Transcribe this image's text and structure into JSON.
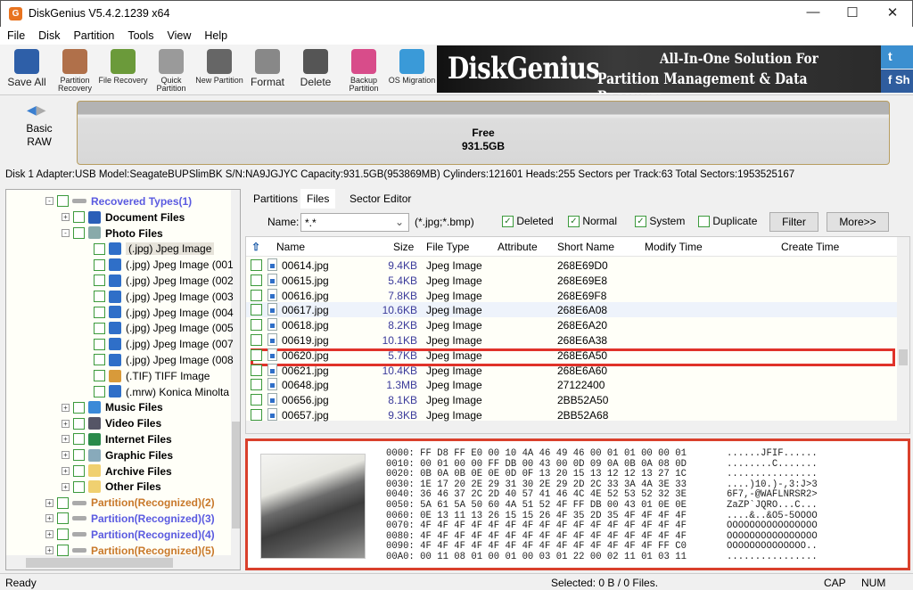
{
  "window": {
    "title": "DiskGenius V5.4.2.1239 x64",
    "logo": "G"
  },
  "menu": [
    "File",
    "Disk",
    "Partition",
    "Tools",
    "View",
    "Help"
  ],
  "toolbar": [
    {
      "label": "Save All",
      "icon": "save-icon",
      "color": "#2e5fa8",
      "big": true
    },
    {
      "label": "Partition Recovery",
      "icon": "magnifier-icon",
      "color": "#b0704a"
    },
    {
      "label": "File Recovery",
      "icon": "file-recovery-icon",
      "color": "#6b9a3a"
    },
    {
      "label": "Quick Partition",
      "icon": "quick-partition-icon",
      "color": "#9a9a9a"
    },
    {
      "label": "New Partition",
      "icon": "layers-icon",
      "color": "#666"
    },
    {
      "label": "Format",
      "icon": "format-icon",
      "color": "#888",
      "big": true
    },
    {
      "label": "Delete",
      "icon": "trash-icon",
      "color": "#555",
      "big": true
    },
    {
      "label": "Backup Partition",
      "icon": "backup-icon",
      "color": "#d84c8a"
    },
    {
      "label": "OS Migration",
      "icon": "os-migration-icon",
      "color": "#3a9ad8"
    }
  ],
  "banner": {
    "brand": "DiskGenius",
    "line1": "All-In-One Solution For",
    "line2": "Partition Management & Data Recovery"
  },
  "social": {
    "twitter": "t",
    "facebook": "f  Sh"
  },
  "diskmap": {
    "type": "Basic",
    "style": "RAW",
    "free_label": "Free",
    "free_size": "931.5GB"
  },
  "disk_info": "Disk 1 Adapter:USB  Model:SeagateBUPSlimBK  S/N:NA9JGJYC  Capacity:931.5GB(953869MB)  Cylinders:121601  Heads:255  Sectors per Track:63  Total Sectors:1953525167",
  "tree": [
    {
      "label": "Recovered Types(1)",
      "level": 0,
      "pm": "-",
      "color": "#5a5ae0",
      "bold": true,
      "icon": "drive-icon"
    },
    {
      "label": "Document Files",
      "level": 1,
      "pm": "+",
      "bold": true,
      "icon": "word-icon"
    },
    {
      "label": "Photo Files",
      "level": 1,
      "pm": "-",
      "bold": true,
      "icon": "photo-icon"
    },
    {
      "label": "(.jpg) Jpeg Image",
      "level": 2,
      "icon": "jpeg-icon",
      "selected": true
    },
    {
      "label": "(.jpg) Jpeg Image (001",
      "level": 2,
      "icon": "jpeg-icon"
    },
    {
      "label": "(.jpg) Jpeg Image (002",
      "level": 2,
      "icon": "jpeg-icon"
    },
    {
      "label": "(.jpg) Jpeg Image (003",
      "level": 2,
      "icon": "jpeg-icon"
    },
    {
      "label": "(.jpg) Jpeg Image (004",
      "level": 2,
      "icon": "jpeg-icon"
    },
    {
      "label": "(.jpg) Jpeg Image (005",
      "level": 2,
      "icon": "jpeg-icon"
    },
    {
      "label": "(.jpg) Jpeg Image (007",
      "level": 2,
      "icon": "jpeg-icon"
    },
    {
      "label": "(.jpg) Jpeg Image (008",
      "level": 2,
      "icon": "jpeg-icon"
    },
    {
      "label": "(.TIF) TIFF Image",
      "level": 2,
      "icon": "tiff-icon"
    },
    {
      "label": "(.mrw) Konica Minolta",
      "level": 2,
      "icon": "jpeg-icon"
    },
    {
      "label": "Music Files",
      "level": 1,
      "pm": "+",
      "bold": true,
      "icon": "music-icon"
    },
    {
      "label": "Video Files",
      "level": 1,
      "pm": "+",
      "bold": true,
      "icon": "video-icon"
    },
    {
      "label": "Internet Files",
      "level": 1,
      "pm": "+",
      "bold": true,
      "icon": "globe-icon"
    },
    {
      "label": "Graphic Files",
      "level": 1,
      "pm": "+",
      "bold": true,
      "icon": "graphic-icon"
    },
    {
      "label": "Archive Files",
      "level": 1,
      "pm": "+",
      "bold": true,
      "icon": "archive-icon"
    },
    {
      "label": "Other Files",
      "level": 1,
      "pm": "+",
      "bold": true,
      "icon": "other-files-icon"
    },
    {
      "label": "Partition(Recognized)(2)",
      "level": 0,
      "pm": "+",
      "color": "#c8782a",
      "bold": true,
      "icon": "drive-icon"
    },
    {
      "label": "Partition(Recognized)(3)",
      "level": 0,
      "pm": "+",
      "color": "#5a5ae0",
      "bold": true,
      "icon": "drive-icon"
    },
    {
      "label": "Partition(Recognized)(4)",
      "level": 0,
      "pm": "+",
      "color": "#5a5ae0",
      "bold": true,
      "icon": "drive-icon"
    },
    {
      "label": "Partition(Recognized)(5)",
      "level": 0,
      "pm": "+",
      "color": "#c8782a",
      "bold": true,
      "icon": "drive-icon"
    }
  ],
  "tabs": [
    {
      "label": "Partitions"
    },
    {
      "label": "Files",
      "active": true
    },
    {
      "label": "Sector Editor"
    }
  ],
  "filter": {
    "name_label": "Name:",
    "name_value": "*.*",
    "hint": "(*.jpg;*.bmp)",
    "deleted": "Deleted",
    "normal": "Normal",
    "system": "System",
    "duplicate": "Duplicate",
    "deleted_checked": true,
    "normal_checked": true,
    "system_checked": true,
    "duplicate_checked": false,
    "filter_btn": "Filter",
    "more_btn": "More>>"
  },
  "columns": [
    "Name",
    "Size",
    "File Type",
    "Attribute",
    "Short Name",
    "Modify Time",
    "Create Time"
  ],
  "files": [
    [
      "00614.jpg",
      "9.4KB",
      "Jpeg Image",
      "",
      "268E69D0"
    ],
    [
      "00615.jpg",
      "5.4KB",
      "Jpeg Image",
      "",
      "268E69E8"
    ],
    [
      "00616.jpg",
      "7.8KB",
      "Jpeg Image",
      "",
      "268E69F8"
    ],
    [
      "00617.jpg",
      "10.6KB",
      "Jpeg Image",
      "",
      "268E6A08"
    ],
    [
      "00618.jpg",
      "8.2KB",
      "Jpeg Image",
      "",
      "268E6A20"
    ],
    [
      "00619.jpg",
      "10.1KB",
      "Jpeg Image",
      "",
      "268E6A38"
    ],
    [
      "00620.jpg",
      "5.7KB",
      "Jpeg Image",
      "",
      "268E6A50"
    ],
    [
      "00621.jpg",
      "10.4KB",
      "Jpeg Image",
      "",
      "268E6A60"
    ],
    [
      "00648.jpg",
      "1.3MB",
      "Jpeg Image",
      "",
      "27122400"
    ],
    [
      "00656.jpg",
      "8.1KB",
      "Jpeg Image",
      "",
      "2BB52A50"
    ],
    [
      "00657.jpg",
      "9.3KB",
      "Jpeg Image",
      "",
      "2BB52A68"
    ]
  ],
  "selected_file": "00617.jpg",
  "hex": [
    "0000: FF D8 FF E0 00 10 4A 46 49 46 00 01 01 00 00 01",
    "0010: 00 01 00 00 FF DB 00 43 00 0D 09 0A 0B 0A 08 0D",
    "0020: 0B 0A 0B 0E 0E 0D 0F 13 20 15 13 12 12 13 27 1C",
    "0030: 1E 17 20 2E 29 31 30 2E 29 2D 2C 33 3A 4A 3E 33",
    "0040: 36 46 37 2C 2D 40 57 41 46 4C 4E 52 53 52 32 3E",
    "0050: 5A 61 5A 50 60 4A 51 52 4F FF DB 00 43 01 0E 0E",
    "0060: 0E 13 11 13 26 15 15 26 4F 35 2D 35 4F 4F 4F 4F",
    "0070: 4F 4F 4F 4F 4F 4F 4F 4F 4F 4F 4F 4F 4F 4F 4F 4F",
    "0080: 4F 4F 4F 4F 4F 4F 4F 4F 4F 4F 4F 4F 4F 4F 4F 4F",
    "0090: 4F 4F 4F 4F 4F 4F 4F 4F 4F 4F 4F 4F 4F 4F FF C0",
    "00A0: 00 11 08 01 00 01 00 03 01 22 00 02 11 01 03 11"
  ],
  "ascii": [
    "......JFIF......",
    "........C.......",
    "................",
    "....)10.)-,3:J>3",
    "6F7,-@WAFLNRSR2>",
    "ZaZP`JQRO...C...",
    "....&..&O5-5OOOO",
    "OOOOOOOOOOOOOOOO",
    "OOOOOOOOOOOOOOOO",
    "OOOOOOOOOOOOOO..",
    "................"
  ],
  "status": {
    "left": "Ready",
    "selected": "Selected: 0 B / 0 Files.",
    "cap": "CAP",
    "num": "NUM"
  }
}
